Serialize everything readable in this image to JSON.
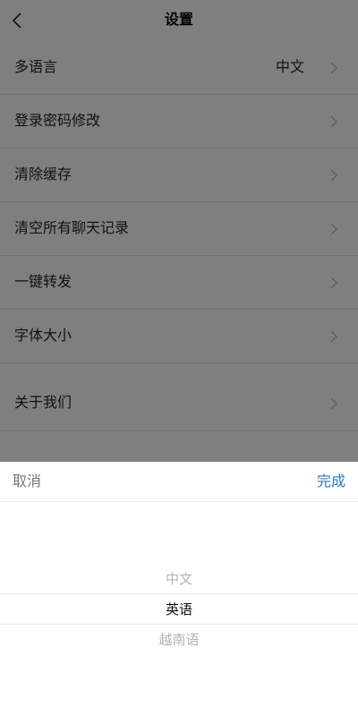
{
  "header": {
    "title": "设置"
  },
  "settings": {
    "language_label": "多语言",
    "language_value": "中文",
    "password_label": "登录密码修改",
    "clear_cache_label": "清除缓存",
    "clear_chats_label": "清空所有聊天记录",
    "forward_label": "一键转发",
    "font_size_label": "字体大小",
    "about_label": "关于我们"
  },
  "picker": {
    "cancel_label": "取消",
    "done_label": "完成",
    "options": [
      "中文",
      "英语",
      "越南语"
    ],
    "selected_index": 1
  },
  "colors": {
    "accent": "#2b78c2",
    "overlay": "#808080"
  },
  "icons": {
    "back": "chevron-left-icon",
    "row_arrow": "chevron-right-icon"
  }
}
